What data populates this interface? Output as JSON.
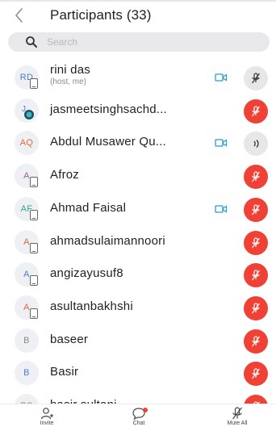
{
  "header": {
    "title": "Participants (33)"
  },
  "search": {
    "placeholder": "Search",
    "value": ""
  },
  "participants": [
    {
      "initials": "RD",
      "initials_color": "#4a7fd4",
      "name": "rini das",
      "role": "(host, me)",
      "device": true,
      "video": true,
      "mic": "muted",
      "mic_style": "gray"
    },
    {
      "initials": "J",
      "initials_color": "#4a7fd4",
      "name": "jasmeetsinghsachd...",
      "role": "",
      "device": false,
      "video": false,
      "mic": "muted",
      "mic_style": "red",
      "has_photo": true
    },
    {
      "initials": "AQ",
      "initials_color": "#e0683a",
      "name": "Abdul Musawer Qu...",
      "role": "",
      "device": false,
      "video": true,
      "mic": "speaking",
      "mic_style": "gray"
    },
    {
      "initials": "A",
      "initials_color": "#9b59b6",
      "name": "Afroz",
      "role": "",
      "device": true,
      "video": false,
      "mic": "muted",
      "mic_style": "red"
    },
    {
      "initials": "AF",
      "initials_color": "#2aa89a",
      "name": "Ahmad Faisal",
      "role": "",
      "device": true,
      "video": true,
      "mic": "muted",
      "mic_style": "red"
    },
    {
      "initials": "A",
      "initials_color": "#e0683a",
      "name": "ahmadsulaimannoori",
      "role": "",
      "device": true,
      "video": false,
      "mic": "muted",
      "mic_style": "red"
    },
    {
      "initials": "A",
      "initials_color": "#4a7fd4",
      "name": "angizayusuf8",
      "role": "",
      "device": true,
      "video": false,
      "mic": "muted",
      "mic_style": "red"
    },
    {
      "initials": "A",
      "initials_color": "#e0683a",
      "name": "asultanbakhshi",
      "role": "",
      "device": true,
      "video": false,
      "mic": "muted",
      "mic_style": "red"
    },
    {
      "initials": "B",
      "initials_color": "#888888",
      "name": "baseer",
      "role": "",
      "device": false,
      "video": false,
      "mic": "muted",
      "mic_style": "red"
    },
    {
      "initials": "B",
      "initials_color": "#4a7fd4",
      "name": "Basir",
      "role": "",
      "device": false,
      "video": false,
      "mic": "muted",
      "mic_style": "red"
    },
    {
      "initials": "BS",
      "initials_color": "#888888",
      "name": "basir sultani",
      "role": "",
      "device": true,
      "video": false,
      "mic": "muted",
      "mic_style": "red"
    }
  ],
  "tabbar": {
    "invite_label": "Invite",
    "chat_label": "Chat",
    "mute_all_label": "Mute All"
  },
  "colors": {
    "accent_red": "#ef4135",
    "video_blue": "#2a9ad8",
    "search_bg": "#e9e9ec"
  }
}
